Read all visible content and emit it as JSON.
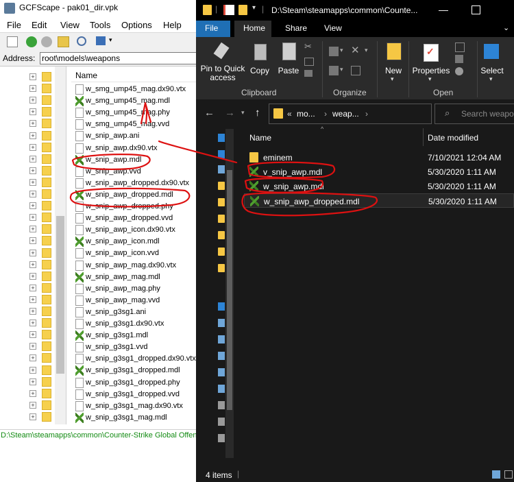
{
  "gcfscape": {
    "title": "GCFScape - pak01_dir.vpk",
    "menu": [
      "File",
      "Edit",
      "View",
      "Tools",
      "Options",
      "Help"
    ],
    "address_label": "Address:",
    "address_value": "root\\models\\weapons",
    "column_name": "Name",
    "files": [
      {
        "name": "w_smg_ump45_mag.dx90.vtx",
        "icon": "blank"
      },
      {
        "name": "w_smg_ump45_mag.mdl",
        "icon": "mdl"
      },
      {
        "name": "w_smg_ump45_mag.phy",
        "icon": "blank"
      },
      {
        "name": "w_smg_ump45_mag.vvd",
        "icon": "blank"
      },
      {
        "name": "w_snip_awp.ani",
        "icon": "blank"
      },
      {
        "name": "w_snip_awp.dx90.vtx",
        "icon": "blank"
      },
      {
        "name": "w_snip_awp.mdl",
        "icon": "mdl"
      },
      {
        "name": "w_snip_awp.vvd",
        "icon": "blank"
      },
      {
        "name": "w_snip_awp_dropped.dx90.vtx",
        "icon": "blank"
      },
      {
        "name": "w_snip_awp_dropped.mdl",
        "icon": "mdl"
      },
      {
        "name": "w_snip_awp_dropped.phy",
        "icon": "blank"
      },
      {
        "name": "w_snip_awp_dropped.vvd",
        "icon": "blank"
      },
      {
        "name": "w_snip_awp_icon.dx90.vtx",
        "icon": "blank"
      },
      {
        "name": "w_snip_awp_icon.mdl",
        "icon": "mdl"
      },
      {
        "name": "w_snip_awp_icon.vvd",
        "icon": "blank"
      },
      {
        "name": "w_snip_awp_mag.dx90.vtx",
        "icon": "blank"
      },
      {
        "name": "w_snip_awp_mag.mdl",
        "icon": "mdl"
      },
      {
        "name": "w_snip_awp_mag.phy",
        "icon": "blank"
      },
      {
        "name": "w_snip_awp_mag.vvd",
        "icon": "blank"
      },
      {
        "name": "w_snip_g3sg1.ani",
        "icon": "blank"
      },
      {
        "name": "w_snip_g3sg1.dx90.vtx",
        "icon": "blank"
      },
      {
        "name": "w_snip_g3sg1.mdl",
        "icon": "mdl"
      },
      {
        "name": "w_snip_g3sg1.vvd",
        "icon": "blank"
      },
      {
        "name": "w_snip_g3sg1_dropped.dx90.vtx",
        "icon": "blank"
      },
      {
        "name": "w_snip_g3sg1_dropped.mdl",
        "icon": "mdl"
      },
      {
        "name": "w_snip_g3sg1_dropped.phy",
        "icon": "blank"
      },
      {
        "name": "w_snip_g3sg1_dropped.vvd",
        "icon": "blank"
      },
      {
        "name": "w_snip_g3sg1_mag.dx90.vtx",
        "icon": "blank"
      },
      {
        "name": "w_snip_g3sg1_mag.mdl",
        "icon": "mdl"
      }
    ],
    "status_path": "D:\\Steam\\steamapps\\common\\Counter-Strike Global Offensive"
  },
  "explorer": {
    "title_path": "D:\\Steam\\steamapps\\common\\Counte...",
    "tabs": [
      "File",
      "Home",
      "Share",
      "View"
    ],
    "ribbon": {
      "pin_label": "Pin to Quick access",
      "copy_label": "Copy",
      "paste_label": "Paste",
      "new_label": "New",
      "properties_label": "Properties",
      "select_label": "Select",
      "groups": [
        "Clipboard",
        "Organize",
        "Open"
      ]
    },
    "breadcrumb": [
      "«",
      "mo...",
      "›",
      "weap...",
      "›"
    ],
    "search_placeholder": "Search weapons",
    "columns": {
      "name": "Name",
      "date": "Date modified"
    },
    "rows": [
      {
        "name": "eminem",
        "date": "7/10/2021 12:04 AM",
        "icon": "folder"
      },
      {
        "name": "v_snip_awp.mdl",
        "date": "5/30/2020 1:11 AM",
        "icon": "mdl"
      },
      {
        "name": "w_snip_awp.mdl",
        "date": "5/30/2020 1:11 AM",
        "icon": "mdl"
      },
      {
        "name": "w_snip_awp_dropped.mdl",
        "date": "5/30/2020 1:11 AM",
        "icon": "mdl"
      }
    ],
    "status_count": "4 items"
  },
  "colors": {
    "annotation": "#dd1111",
    "explorer_bg": "#191919",
    "file_tab": "#1f6fb5",
    "status_green": "#118a11"
  }
}
